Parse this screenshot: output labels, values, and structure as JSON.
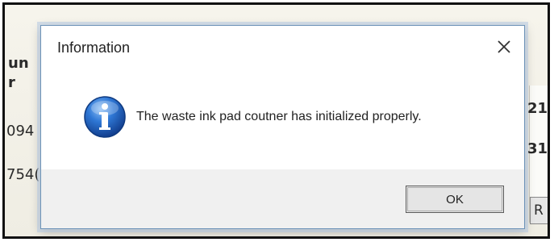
{
  "background": {
    "fragment_1": "un",
    "fragment_2": "r",
    "fragment_3": "094",
    "fragment_4": "754(",
    "fragment_5": "21",
    "fragment_6": "31",
    "fragment_7": "R"
  },
  "dialog": {
    "title": "Information",
    "message": "The waste ink pad coutner has initialized properly.",
    "ok_label": "OK",
    "icon": "info-icon",
    "close_icon": "close-icon"
  },
  "colors": {
    "info_icon_blue": "#1f63c4",
    "dialog_border": "#6d93b8"
  }
}
